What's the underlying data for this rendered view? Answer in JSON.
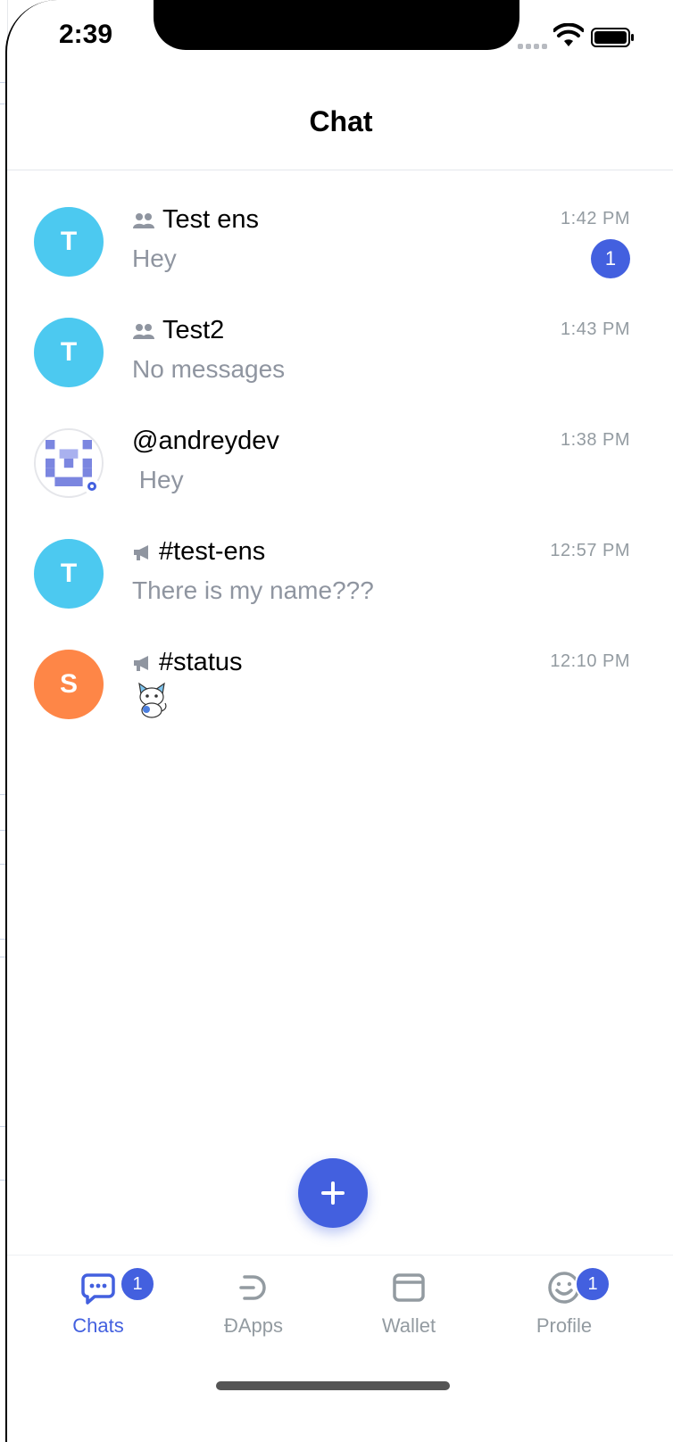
{
  "status_bar": {
    "time": "2:39"
  },
  "header": {
    "title": "Chat"
  },
  "chats": [
    {
      "name": "Test ens",
      "kind": "group",
      "preview": "Hey",
      "time": "1:42 PM",
      "unread": "1",
      "avatar_letter": "T",
      "avatar_color": "#4cc9f0"
    },
    {
      "name": "Test2",
      "kind": "group",
      "preview": "No messages",
      "time": "1:43 PM",
      "unread": "",
      "avatar_letter": "T",
      "avatar_color": "#4cc9f0"
    },
    {
      "name": "@andreydev",
      "kind": "contact",
      "preview": " Hey",
      "time": "1:38 PM",
      "unread": "",
      "avatar_letter": "",
      "avatar_color": "#ffffff"
    },
    {
      "name": "#test-ens",
      "kind": "public",
      "preview": "There is my name???",
      "time": "12:57 PM",
      "unread": "",
      "avatar_letter": "T",
      "avatar_color": "#4cc9f0"
    },
    {
      "name": "#status",
      "kind": "public",
      "preview": "",
      "time": "12:10 PM",
      "unread": "",
      "avatar_letter": "S",
      "avatar_color": "#fe8647"
    }
  ],
  "tabs": [
    {
      "label": "Chats",
      "badge": "1",
      "icon": "chat-bubble-icon"
    },
    {
      "label": "ÐApps",
      "badge": "",
      "icon": "dapps-icon"
    },
    {
      "label": "Wallet",
      "badge": "",
      "icon": "wallet-icon"
    },
    {
      "label": "Profile",
      "badge": "1",
      "icon": "profile-smiley-icon"
    }
  ],
  "colors": {
    "accent": "#4360df",
    "muted": "#939ba1"
  }
}
